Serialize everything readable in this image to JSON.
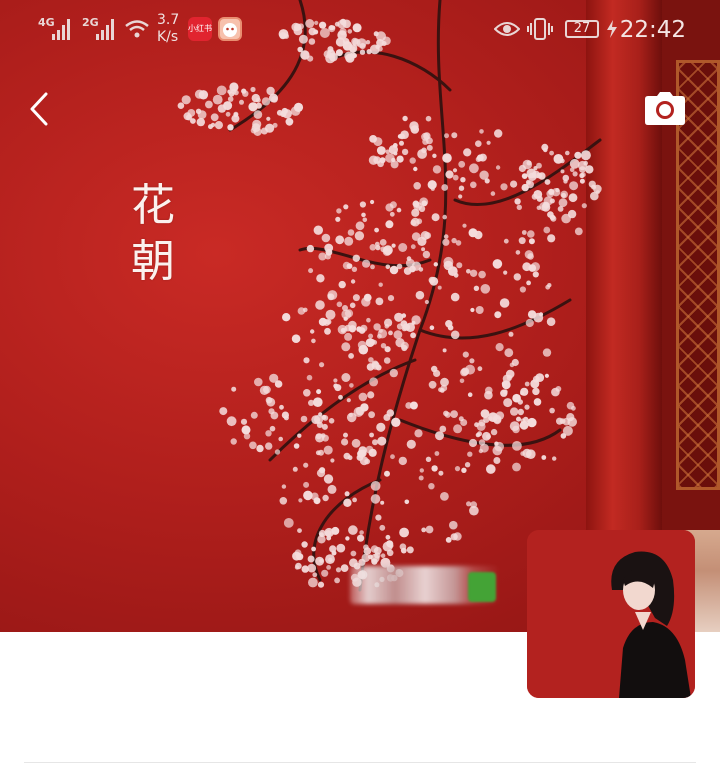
{
  "status_bar": {
    "signal1_label": "4G",
    "signal2_label": "2G",
    "net_speed_value": "3.7",
    "net_speed_unit": "K/s",
    "app_icon_1": "小红书",
    "battery_level": "27",
    "time": "22:42",
    "icons": [
      "eye-icon",
      "vibrate-icon",
      "charging-icon",
      "wifi-icon"
    ]
  },
  "header": {
    "back_icon": "chevron-left-icon",
    "camera_icon": "camera-icon"
  },
  "cover": {
    "title_line1": "花",
    "title_line2": "朝"
  },
  "colors": {
    "wall_red": "#b01f1c",
    "pillar_red": "#c22a22",
    "blossom": "#f4dcdc"
  }
}
